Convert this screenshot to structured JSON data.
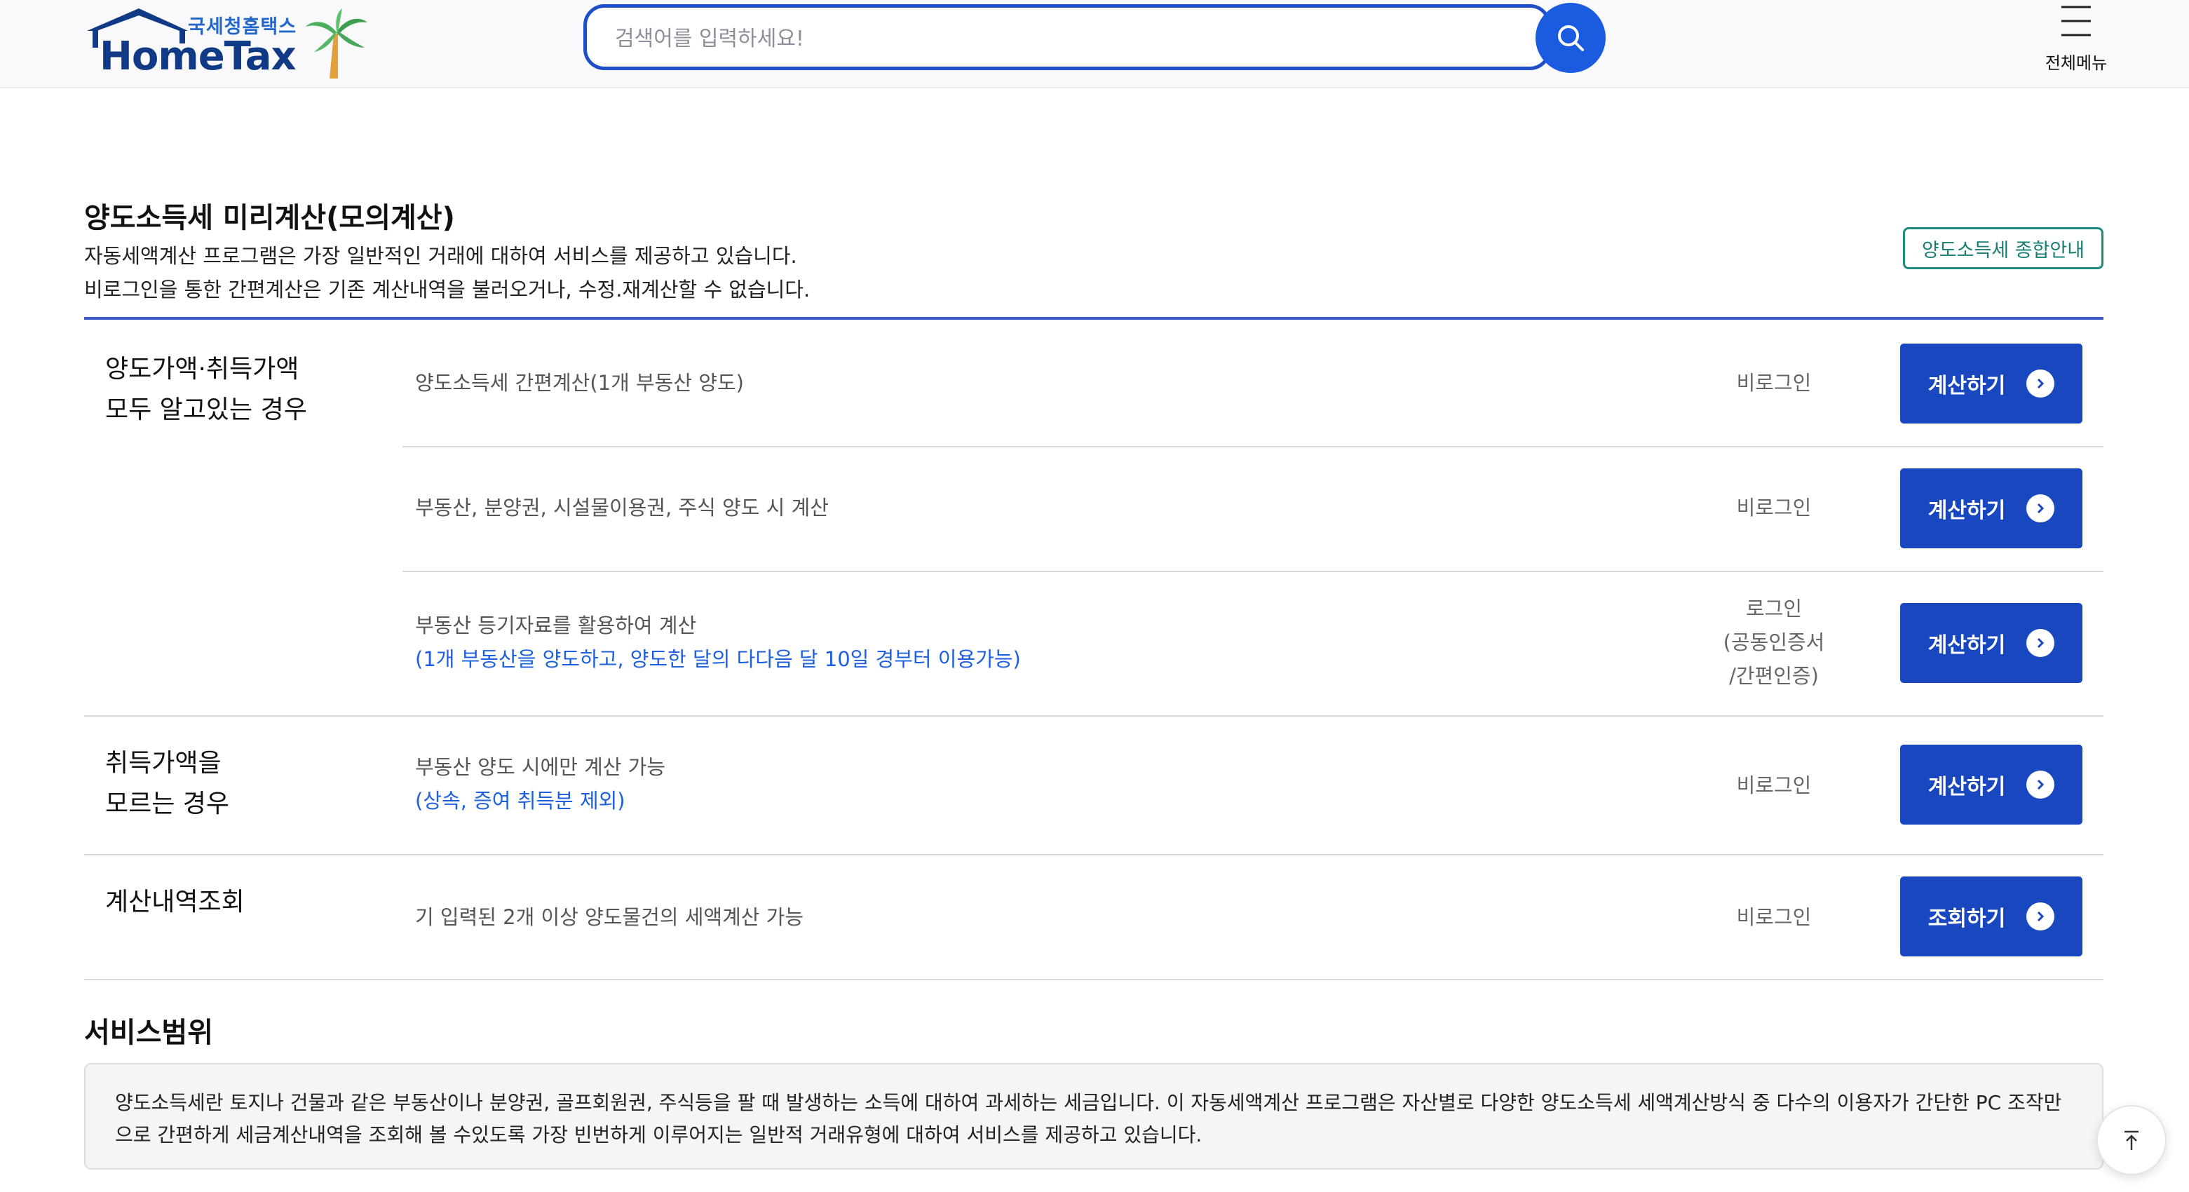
{
  "header": {
    "logo_tag": "국세청홈택스",
    "logo_word": "HomeTax",
    "search_placeholder": "검색어를 입력하세요!",
    "menu_label": "전체메뉴"
  },
  "intro": {
    "title": "양도소득세 미리계산(모의계산)",
    "desc1": "자동세액계산 프로그램은 가장 일반적인 거래에 대하여 서비스를 제공하고 있습니다.",
    "desc2": "비로그인을 통한 간편계산은 기존 계산내역을 불러오거나, 수정.재계산할 수 없습니다.",
    "guide_button": "양도소득세 종합안내"
  },
  "sections": [
    {
      "category_line1": "양도가액·취득가액",
      "category_line2": "모두 알고있는 경우",
      "rows": [
        {
          "text": "양도소득세 간편계산(1개 부동산 양도)",
          "status": "비로그인",
          "button": "계산하기"
        },
        {
          "text": "부동산, 분양권, 시설물이용권, 주식 양도 시 계산",
          "status": "비로그인",
          "button": "계산하기"
        },
        {
          "text": "부동산 등기자료를 활용하여 계산",
          "note": "(1개 부동산을 양도하고, 양도한 달의 다다음 달 10일 경부터 이용가능)",
          "status_line1": "로그인",
          "status_line2": "(공동인증서",
          "status_line3": "/간편인증)",
          "button": "계산하기"
        }
      ]
    },
    {
      "category_line1": "취득가액을",
      "category_line2": "모르는 경우",
      "rows": [
        {
          "text": "부동산 양도 시에만 계산 가능",
          "note": "(상속, 증여 취득분 제외)",
          "status": "비로그인",
          "button": "계산하기"
        }
      ]
    },
    {
      "category_line1": "계산내역조회",
      "rows": [
        {
          "text": "기 입력된 2개 이상 양도물건의 세액계산 가능",
          "status": "비로그인",
          "button": "조회하기"
        }
      ]
    }
  ],
  "scope": {
    "title": "서비스범위",
    "text_line1": "양도소득세란 토지나 건물과 같은 부동산이나 분양권, 골프회원권, 주식등을 팔 때 발생하는 소득에 대하여 과세하는 세금입니다. 이 자동세액계산 프로그램은 자산별로 다양한 양도소득세 세액계산방식 중 다수의 이용자가 간단한 PC 조작만",
    "text_line2": "으로 간편하게 세금계산내역을 조회해 볼 수있도록 가장 빈번하게 이루어지는 일반적 거래유형에 대하여 서비스를 제공하고 있습니다."
  },
  "colors": {
    "primary_button": "#1847c0",
    "search_border": "#1e4fc9",
    "note_text": "#1c5fe0",
    "guide_border": "#1f8a7e"
  }
}
